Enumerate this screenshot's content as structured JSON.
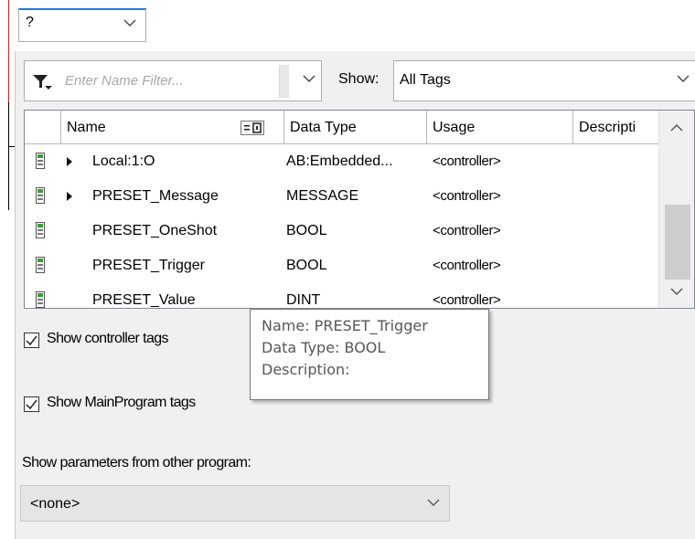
{
  "top_selector": {
    "value": "?"
  },
  "filter": {
    "placeholder": "Enter Name Filter..."
  },
  "show": {
    "label": "Show:",
    "value": "All Tags"
  },
  "table": {
    "columns": [
      "Name",
      "Data Type",
      "Usage",
      "Descripti"
    ],
    "rows": [
      {
        "name": "Local:1:O",
        "type": "AB:Embedded...",
        "usage": "<controller>",
        "expandable": true
      },
      {
        "name": "PRESET_Message",
        "type": "MESSAGE",
        "usage": "<controller>",
        "expandable": true
      },
      {
        "name": "PRESET_OneShot",
        "type": "BOOL",
        "usage": "<controller>",
        "expandable": false
      },
      {
        "name": "PRESET_Trigger",
        "type": "BOOL",
        "usage": "<controller>",
        "expandable": false
      },
      {
        "name": "PRESET_Value",
        "type": "DINT",
        "usage": "<controller>",
        "expandable": false
      }
    ]
  },
  "tooltip": {
    "line1": "Name: PRESET_Trigger",
    "line2": "Data Type: BOOL",
    "line3": "Description:"
  },
  "options": {
    "show_controller_tags": {
      "label": "Show controller tags",
      "checked": true
    },
    "show_mainprogram_tags": {
      "label": "Show MainProgram tags",
      "checked": true
    }
  },
  "params": {
    "label": "Show parameters from other program:",
    "value": "<none>"
  },
  "colors": {
    "accent_border": "#1e7bd7",
    "marker": "#e02020",
    "tag_icon": "#3a9b3a"
  },
  "icons": [
    "filter-icon",
    "chevron-down-icon",
    "expander-triangle-icon",
    "tag-icon",
    "column-chooser-icon",
    "scroll-up-icon",
    "scroll-down-icon",
    "checkmark-icon"
  ]
}
